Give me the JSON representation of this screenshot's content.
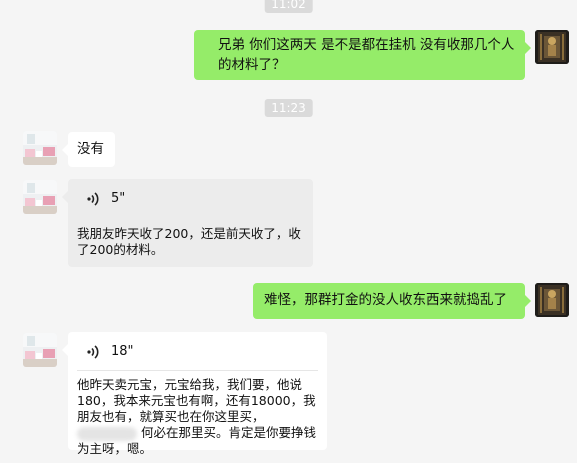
{
  "chat": {
    "timestamps": [
      "11:02",
      "11:23"
    ],
    "messages": [
      {
        "side": "right",
        "text": "兄弟 你们这两天 是不是都在挂机 没有收那几个人的材料了？"
      },
      {
        "side": "left",
        "text": "没有"
      },
      {
        "side": "left",
        "type": "voice",
        "duration": "5\"",
        "transcript": "我朋友昨天收了200，还是前天收了，收了200的材料。"
      },
      {
        "side": "right",
        "text": "难怪，那群打金的没人收东西来就捣乱了"
      },
      {
        "side": "left",
        "type": "voice",
        "duration": "18\"",
        "transcript_part1": "他昨天卖元宝，元宝给我，我们要，他说180，我本来元宝也有啊，还有18000，我朋友也有，就算买也在你这里买，",
        "transcript_part2": "何必在那里买。肯定是你要挣钱为主呀，嗯。"
      }
    ]
  },
  "colors": {
    "background": "#f5f5f5",
    "self_bubble": "#95ec69",
    "other_bubble": "#ffffff",
    "voice_bubble": "#ececec",
    "timestamp_bg": "#dadada"
  },
  "icons": {
    "voice": "voice-wave-icon",
    "avatar_left": "room-photo-avatar",
    "avatar_right": "dark-statue-avatar"
  }
}
